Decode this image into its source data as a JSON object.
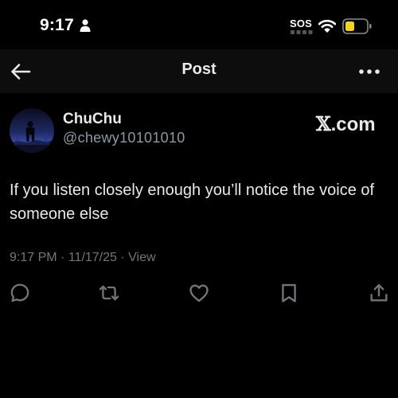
{
  "status_bar": {
    "time": "9:17",
    "sos": "SOS",
    "icons": [
      "person-icon",
      "wifi-icon",
      "battery-icon"
    ],
    "battery_color": "#f7d21a"
  },
  "nav": {
    "title": "Post",
    "back_icon": "arrow-left-icon",
    "more_icon": "more-horizontal-icon"
  },
  "post": {
    "author": {
      "display_name": "ChuChu",
      "username": "@chewy10101010"
    },
    "watermark": {
      "x": "𝕏",
      "suffix": ".com"
    },
    "text": "If you listen closely enough you’ll notice the voice of someone else",
    "meta": {
      "time": "9:17 PM",
      "separator": "·",
      "date": "11/17/25",
      "views_label": "View"
    },
    "actions": [
      {
        "name": "reply",
        "icon": "reply-icon"
      },
      {
        "name": "repost",
        "icon": "repost-icon"
      },
      {
        "name": "like",
        "icon": "heart-icon"
      },
      {
        "name": "bookmark",
        "icon": "bookmark-icon"
      },
      {
        "name": "share",
        "icon": "share-icon"
      }
    ]
  },
  "colors": {
    "background": "#000000",
    "text_primary": "#e7e9ea",
    "text_secondary": "#71767b",
    "nav_background": "#0d0d0d"
  }
}
